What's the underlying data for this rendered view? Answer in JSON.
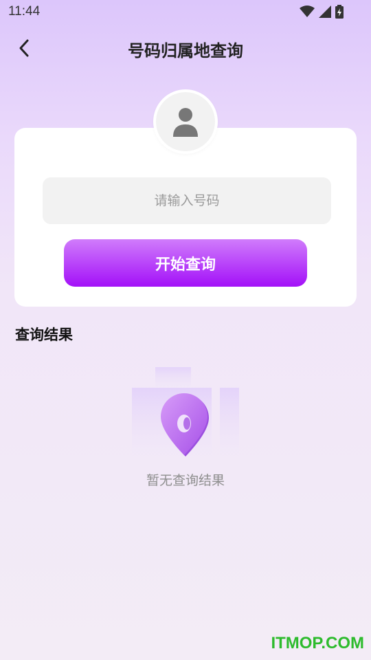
{
  "status_bar": {
    "time": "11:44"
  },
  "header": {
    "title": "号码归属地查询"
  },
  "search": {
    "placeholder": "请输入号码",
    "value": "",
    "button_label": "开始查询"
  },
  "results": {
    "section_title": "查询结果",
    "empty_text": "暂无查询结果"
  },
  "watermark": "ITMOP.COM",
  "colors": {
    "accent_top": "#d07cfb",
    "accent_bottom": "#a310f8",
    "watermark": "#2dbb2d"
  }
}
